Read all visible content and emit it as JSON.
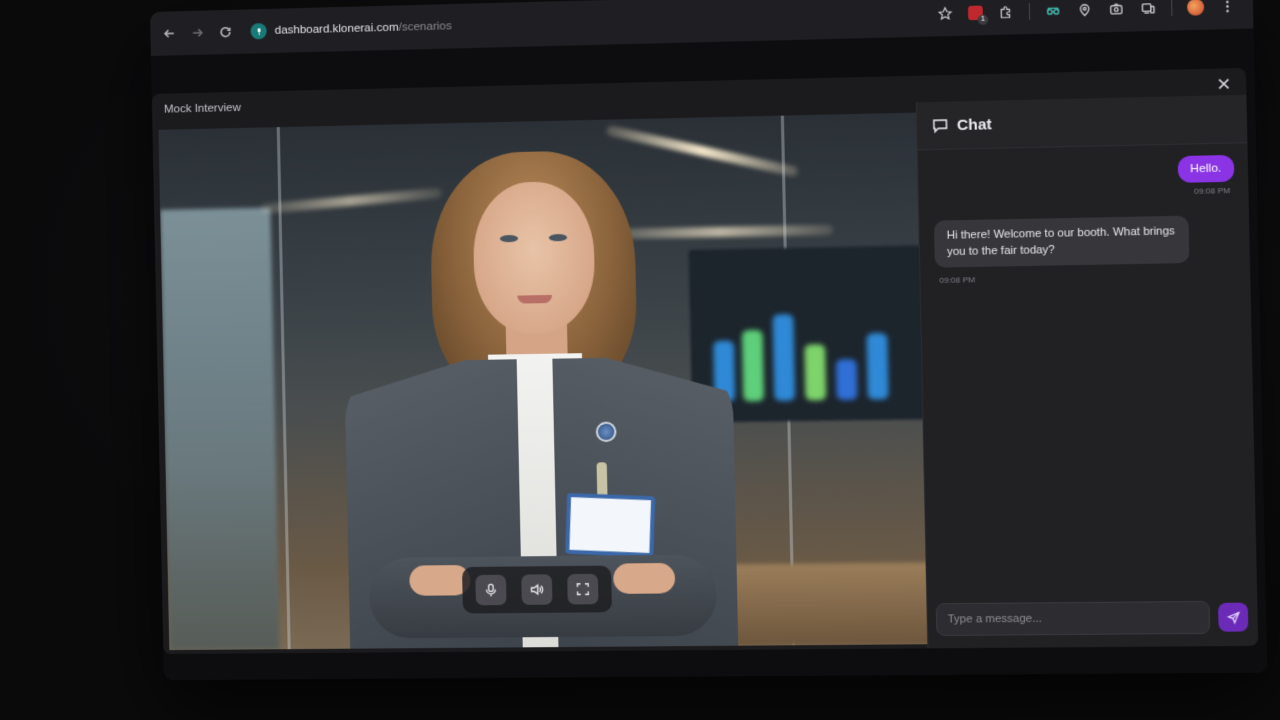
{
  "browser": {
    "url_host": "dashboard.klonerai.com",
    "url_path": "/scenarios",
    "extension_badge": "1"
  },
  "modal": {
    "title": "Mock Interview"
  },
  "video_controls": {
    "mic": "microphone-icon",
    "volume": "speaker-icon",
    "fullscreen": "fullscreen-icon"
  },
  "chat": {
    "header": "Chat",
    "messages": [
      {
        "role": "user",
        "text": "Hello.",
        "time": "09:08 PM"
      },
      {
        "role": "assistant",
        "text": "Hi there! Welcome to our booth. What brings you to the fair today?",
        "time": "09:08 PM"
      }
    ],
    "input_placeholder": "Type a message..."
  },
  "colors": {
    "accent": "#8a34e6",
    "send_button": "#6b2bb8",
    "background": "#0a0a0b"
  }
}
